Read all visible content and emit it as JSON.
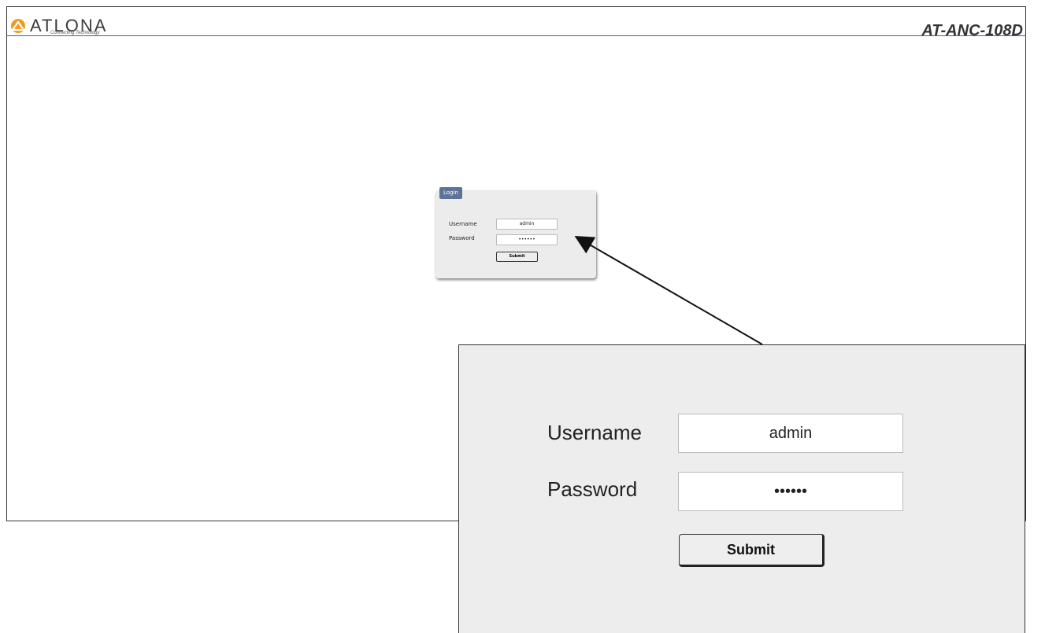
{
  "header": {
    "brand": "ATLONA",
    "tagline": "Connecting Technology",
    "model": "AT-ANC-108D"
  },
  "login": {
    "tab_title": "Login",
    "username_label": "Username",
    "username_value": "admin",
    "password_label": "Password",
    "password_value": "••••••",
    "submit_label": "Submit"
  },
  "colors": {
    "accent": "#5d739a",
    "header_line": "#3a5ea8",
    "logo_orange": "#f29a1f"
  },
  "icons": {
    "logo": "atlona-logo-icon",
    "pointer": "callout-arrow-icon"
  }
}
